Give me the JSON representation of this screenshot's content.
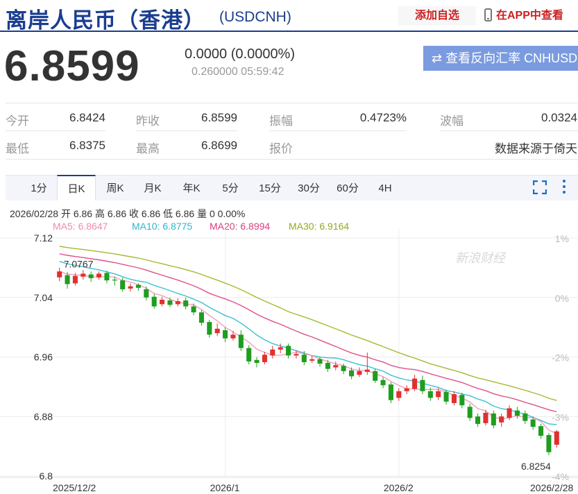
{
  "header": {
    "title": "离岸人民币（香港）",
    "symbol": "(USDCNH)",
    "add_watchlist": "添加自选",
    "app_view": "在APP中查看"
  },
  "quote": {
    "price": "6.8599",
    "change": "0.0000 (0.0000%)",
    "timestamp": "0.260000 05:59:42",
    "reverse_button": "⇄ 查看反向汇率 CNHUSD"
  },
  "stats": {
    "open_label": "今开",
    "open": "6.8424",
    "prev_close_label": "昨收",
    "prev_close": "6.8599",
    "amplitude_label": "振幅",
    "amplitude": "0.4723%",
    "volatility_label": "波幅",
    "volatility": "0.0324",
    "low_label": "最低",
    "low": "6.8375",
    "high_label": "最高",
    "high": "6.8699",
    "quote_label": "报价",
    "source": "数据来源于倚天"
  },
  "tabs": [
    "1分",
    "日K",
    "周K",
    "月K",
    "年K",
    "5分",
    "15分",
    "30分",
    "60分",
    "4H"
  ],
  "active_tab": 1,
  "chart_info": {
    "ohlc": "2026/02/28 开 6.86 高 6.86 收 6.86 低 6.86 量 0 0.00%",
    "ma5": "MA5: 6.8647",
    "ma10": "MA10: 6.8775",
    "ma20": "MA20: 6.8994",
    "ma30": "MA30: 6.9164",
    "watermark": "新浪财经"
  },
  "colors": {
    "up": "#e03030",
    "down": "#1f9d1f",
    "ma5": "#f0a0b8",
    "ma10": "#3bbfd4",
    "ma20": "#e0508a",
    "ma30": "#a8b830"
  },
  "chart_data": {
    "type": "candlestick",
    "x_labels": [
      "2025/12/2",
      "2026/1",
      "2026/2",
      "2026/2/28"
    ],
    "y_ticks": [
      "7.12",
      "7.04",
      "6.96",
      "6.88",
      "6.8"
    ],
    "y_right_ticks": [
      "1%",
      "0%",
      "-2%",
      "-3%",
      "-4%"
    ],
    "ylim": [
      6.8,
      7.12
    ],
    "annotations": {
      "max_label": "7.0767",
      "min_label": "6.8254"
    },
    "candles": [
      {
        "o": 7.067,
        "c": 7.075,
        "h": 7.08,
        "l": 7.062
      },
      {
        "o": 7.07,
        "c": 7.058,
        "h": 7.074,
        "l": 7.052
      },
      {
        "o": 7.059,
        "c": 7.069,
        "h": 7.073,
        "l": 7.056
      },
      {
        "o": 7.068,
        "c": 7.072,
        "h": 7.077,
        "l": 7.064
      },
      {
        "o": 7.071,
        "c": 7.066,
        "h": 7.075,
        "l": 7.061
      },
      {
        "o": 7.067,
        "c": 7.072,
        "h": 7.075,
        "l": 7.064
      },
      {
        "o": 7.073,
        "c": 7.063,
        "h": 7.076,
        "l": 7.059
      },
      {
        "o": 7.064,
        "c": 7.063,
        "h": 7.068,
        "l": 7.056
      },
      {
        "o": 7.063,
        "c": 7.051,
        "h": 7.067,
        "l": 7.048
      },
      {
        "o": 7.052,
        "c": 7.055,
        "h": 7.059,
        "l": 7.048
      },
      {
        "o": 7.057,
        "c": 7.053,
        "h": 7.059,
        "l": 7.049
      },
      {
        "o": 7.051,
        "c": 7.04,
        "h": 7.055,
        "l": 7.036
      },
      {
        "o": 7.041,
        "c": 7.028,
        "h": 7.045,
        "l": 7.025
      },
      {
        "o": 7.031,
        "c": 7.037,
        "h": 7.041,
        "l": 7.028
      },
      {
        "o": 7.036,
        "c": 7.03,
        "h": 7.04,
        "l": 7.027
      },
      {
        "o": 7.031,
        "c": 7.035,
        "h": 7.039,
        "l": 7.028
      },
      {
        "o": 7.036,
        "c": 7.028,
        "h": 7.04,
        "l": 7.024
      },
      {
        "o": 7.028,
        "c": 7.02,
        "h": 7.032,
        "l": 7.016
      },
      {
        "o": 7.02,
        "c": 7.006,
        "h": 7.023,
        "l": 7.002
      },
      {
        "o": 7.007,
        "c": 6.99,
        "h": 7.01,
        "l": 6.986
      },
      {
        "o": 6.992,
        "c": 6.998,
        "h": 7.005,
        "l": 6.988
      },
      {
        "o": 6.996,
        "c": 6.985,
        "h": 7.0,
        "l": 6.98
      },
      {
        "o": 6.985,
        "c": 6.99,
        "h": 6.995,
        "l": 6.982
      },
      {
        "o": 6.99,
        "c": 6.972,
        "h": 6.996,
        "l": 6.968
      },
      {
        "o": 6.972,
        "c": 6.954,
        "h": 6.976,
        "l": 6.95
      },
      {
        "o": 6.956,
        "c": 6.952,
        "h": 6.96,
        "l": 6.946
      },
      {
        "o": 6.953,
        "c": 6.963,
        "h": 6.967,
        "l": 6.95
      },
      {
        "o": 6.962,
        "c": 6.97,
        "h": 6.975,
        "l": 6.958
      },
      {
        "o": 6.97,
        "c": 6.973,
        "h": 6.978,
        "l": 6.965
      },
      {
        "o": 6.975,
        "c": 6.962,
        "h": 6.978,
        "l": 6.958
      },
      {
        "o": 6.962,
        "c": 6.964,
        "h": 6.969,
        "l": 6.958
      },
      {
        "o": 6.963,
        "c": 6.953,
        "h": 6.968,
        "l": 6.949
      },
      {
        "o": 6.955,
        "c": 6.957,
        "h": 6.962,
        "l": 6.952
      },
      {
        "o": 6.957,
        "c": 6.951,
        "h": 6.96,
        "l": 6.947
      },
      {
        "o": 6.952,
        "c": 6.944,
        "h": 6.956,
        "l": 6.94
      },
      {
        "o": 6.946,
        "c": 6.949,
        "h": 6.954,
        "l": 6.942
      },
      {
        "o": 6.948,
        "c": 6.941,
        "h": 6.951,
        "l": 6.937
      },
      {
        "o": 6.942,
        "c": 6.934,
        "h": 6.946,
        "l": 6.93
      },
      {
        "o": 6.936,
        "c": 6.941,
        "h": 6.946,
        "l": 6.933
      },
      {
        "o": 6.94,
        "c": 6.943,
        "h": 6.966,
        "l": 6.936
      },
      {
        "o": 6.941,
        "c": 6.928,
        "h": 6.944,
        "l": 6.925
      },
      {
        "o": 6.929,
        "c": 6.922,
        "h": 6.933,
        "l": 6.918
      },
      {
        "o": 6.923,
        "c": 6.902,
        "h": 6.926,
        "l": 6.898
      },
      {
        "o": 6.905,
        "c": 6.914,
        "h": 6.918,
        "l": 6.901
      },
      {
        "o": 6.914,
        "c": 6.918,
        "h": 6.922,
        "l": 6.91
      },
      {
        "o": 6.917,
        "c": 6.931,
        "h": 6.936,
        "l": 6.914
      },
      {
        "o": 6.929,
        "c": 6.914,
        "h": 6.935,
        "l": 6.91
      },
      {
        "o": 6.914,
        "c": 6.905,
        "h": 6.919,
        "l": 6.901
      },
      {
        "o": 6.906,
        "c": 6.914,
        "h": 6.918,
        "l": 6.902
      },
      {
        "o": 6.913,
        "c": 6.9,
        "h": 6.916,
        "l": 6.896
      },
      {
        "o": 6.898,
        "c": 6.91,
        "h": 6.914,
        "l": 6.895
      },
      {
        "o": 6.909,
        "c": 6.895,
        "h": 6.912,
        "l": 6.891
      },
      {
        "o": 6.893,
        "c": 6.878,
        "h": 6.897,
        "l": 6.874
      },
      {
        "o": 6.88,
        "c": 6.87,
        "h": 6.884,
        "l": 6.866
      },
      {
        "o": 6.871,
        "c": 6.885,
        "h": 6.889,
        "l": 6.868
      },
      {
        "o": 6.884,
        "c": 6.868,
        "h": 6.888,
        "l": 6.864
      },
      {
        "o": 6.872,
        "c": 6.88,
        "h": 6.884,
        "l": 6.866
      },
      {
        "o": 6.878,
        "c": 6.891,
        "h": 6.895,
        "l": 6.875
      },
      {
        "o": 6.888,
        "c": 6.881,
        "h": 6.893,
        "l": 6.877
      },
      {
        "o": 6.884,
        "c": 6.874,
        "h": 6.888,
        "l": 6.87
      },
      {
        "o": 6.876,
        "c": 6.866,
        "h": 6.88,
        "l": 6.862
      },
      {
        "o": 6.867,
        "c": 6.854,
        "h": 6.87,
        "l": 6.85
      },
      {
        "o": 6.855,
        "c": 6.832,
        "h": 6.858,
        "l": 6.828
      },
      {
        "o": 6.842,
        "c": 6.86,
        "h": 6.862,
        "l": 6.838
      }
    ]
  }
}
